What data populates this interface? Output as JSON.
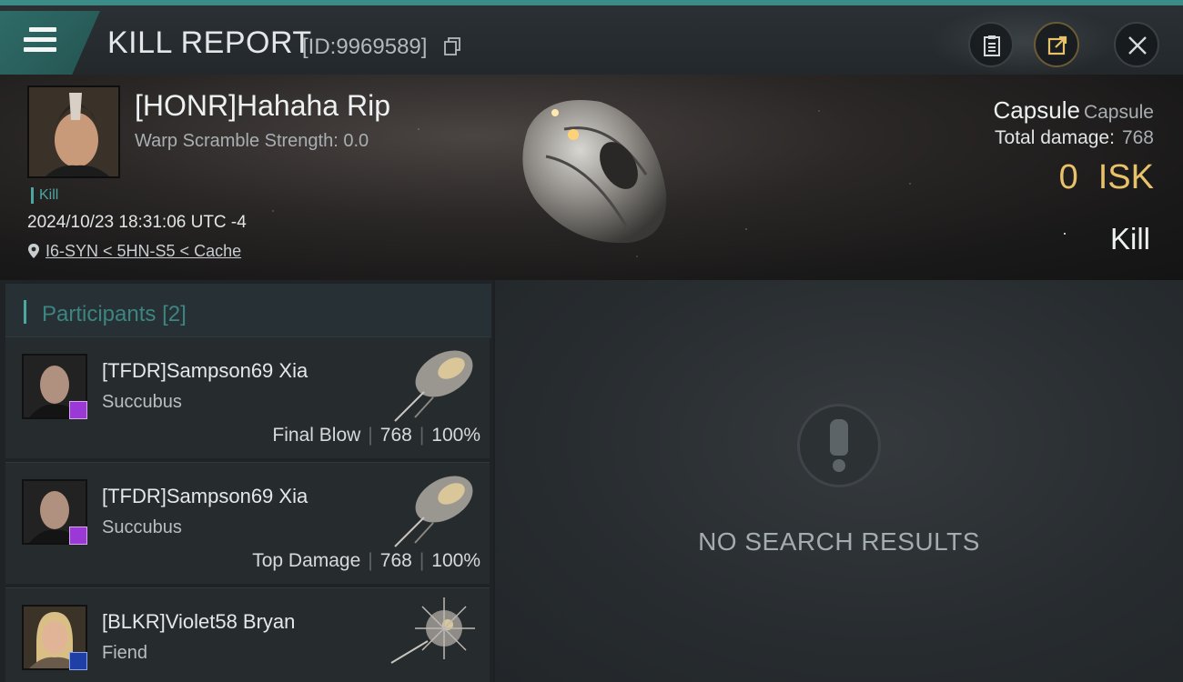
{
  "topbar": {
    "title": "KILL REPORT",
    "report_id": "[ID:9969589]",
    "icons": [
      "menu-icon",
      "copy-icon",
      "clipboard-icon",
      "share-icon",
      "close-icon"
    ],
    "accent_color": "#3b8b86"
  },
  "victim": {
    "name": "[HONR]Hahaha Rip",
    "warp_scramble": "Warp Scramble Strength: 0.0",
    "tag": "Kill",
    "time": "2024/10/23 18:31:06 UTC -4",
    "location": "I6-SYN < 5HN-S5 < Cache",
    "ship_type": "Capsule",
    "ship_class": "Capsule",
    "total_damage_label": "Total damage:",
    "total_damage": "768",
    "isk_value": "0",
    "isk_unit": "ISK",
    "result": "Kill"
  },
  "participants": {
    "title": "Participants",
    "count": "[2]",
    "rows": [
      {
        "name": "[TFDR]Sampson69 Xia",
        "ship": "Succubus",
        "role": "Final Blow",
        "damage": "768",
        "percent": "100%",
        "sep": "|"
      },
      {
        "name": "[TFDR]Sampson69 Xia",
        "ship": "Succubus",
        "role": "Top Damage",
        "damage": "768",
        "percent": "100%",
        "sep": "|"
      },
      {
        "name": "[BLKR]Violet58 Bryan",
        "ship": "Fiend"
      }
    ]
  },
  "results": {
    "empty_text": "NO SEARCH RESULTS"
  }
}
